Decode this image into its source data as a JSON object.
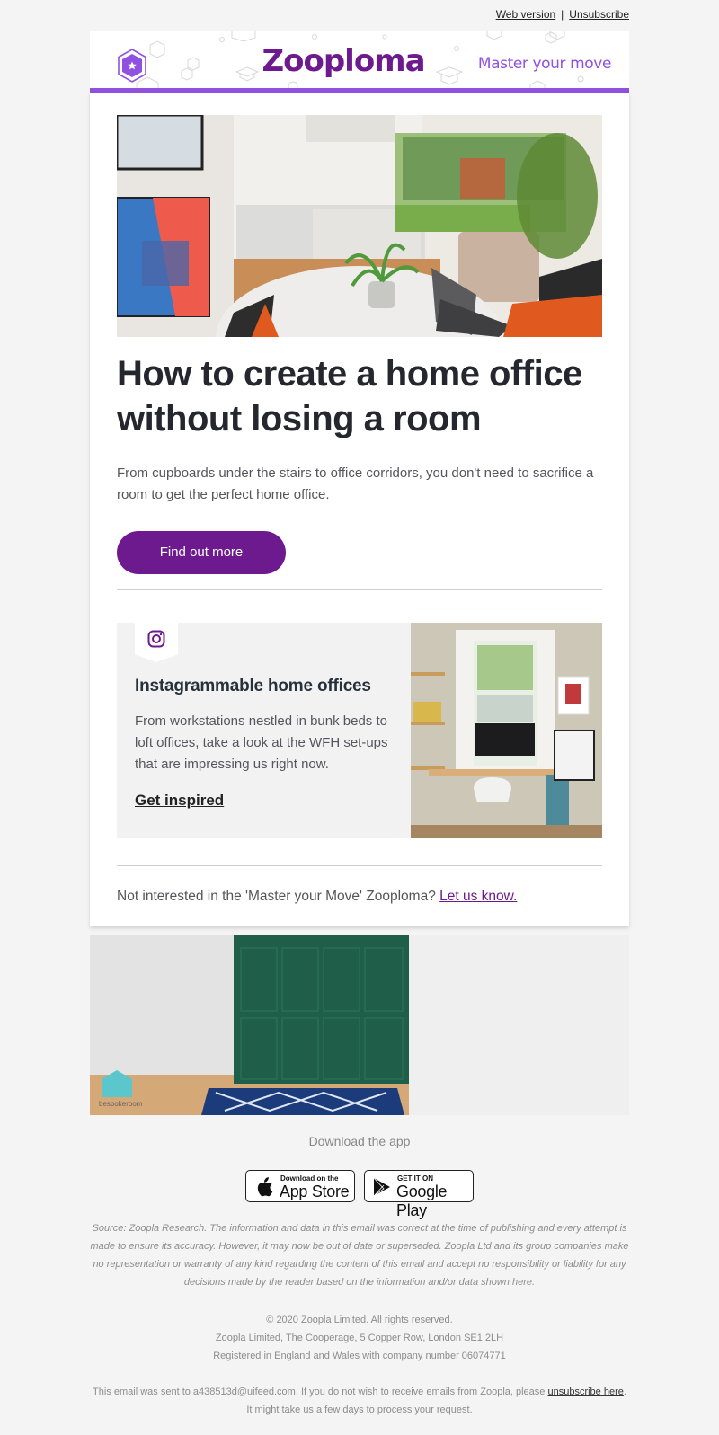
{
  "preheader": {
    "web_version": "Web version",
    "separator": "|",
    "unsubscribe": "Unsubscribe"
  },
  "header": {
    "brand": "Zooploma",
    "tagline": "Master your move",
    "colors": {
      "brand": "#6d1a8e",
      "accent": "#9151e0"
    }
  },
  "hero": {
    "image_alt": "Open-plan kitchen and dining area with marble table, laptop and plant",
    "headline": "How to create a home office without losing a room",
    "intro": "From cupboards under the stairs to office corridors, you don't need to sacrifice a room to get the perfect home office.",
    "cta_label": "Find out more"
  },
  "instagram": {
    "icon": "instagram-icon",
    "title": "Instagrammable home offices",
    "body": "From workstations nestled in bunk beds to loft offices, take a look at the WFH set-ups that are impressing us right now.",
    "link": "Get inspired",
    "image_alt": "Home office desk with iMac in front of a sash window"
  },
  "optout": {
    "text": "Not interested in the 'Master your Move' Zooploma? ",
    "link": "Let us know."
  },
  "banner": {
    "image_alt": "Bespokeroom green panelled wall with navy rug",
    "logo_text": "bespokeroom"
  },
  "app": {
    "label": "Download the app",
    "appstore_small": "Download on the",
    "appstore_big": "App Store",
    "googleplay_small": "GET IT ON",
    "googleplay_big": "Google Play"
  },
  "footer": {
    "disclaimer": "Source: Zoopla Research. The information and data in this email was correct at the time of publishing and every attempt is made to ensure its accuracy. However, it may now be out of date or superseded. Zoopla Ltd and its group companies make no representation or warranty of any kind regarding the content of this email and accept no responsibility or liability for any decisions made by the reader based on the information and/or data shown here.",
    "copyright": "© 2020 Zoopla Limited. All rights reserved.",
    "address": "Zoopla Limited, The Cooperage, 5 Copper Row, London SE1 2LH",
    "registration": "Registered in England and Wales with company number 06074771",
    "sent_pre": "This email was sent to a438513d@uifeed.com. If you do not wish to receive emails from Zoopla, please ",
    "sent_link": "unsubscribe here",
    "sent_post": ". It might take us a few days to process your request."
  }
}
